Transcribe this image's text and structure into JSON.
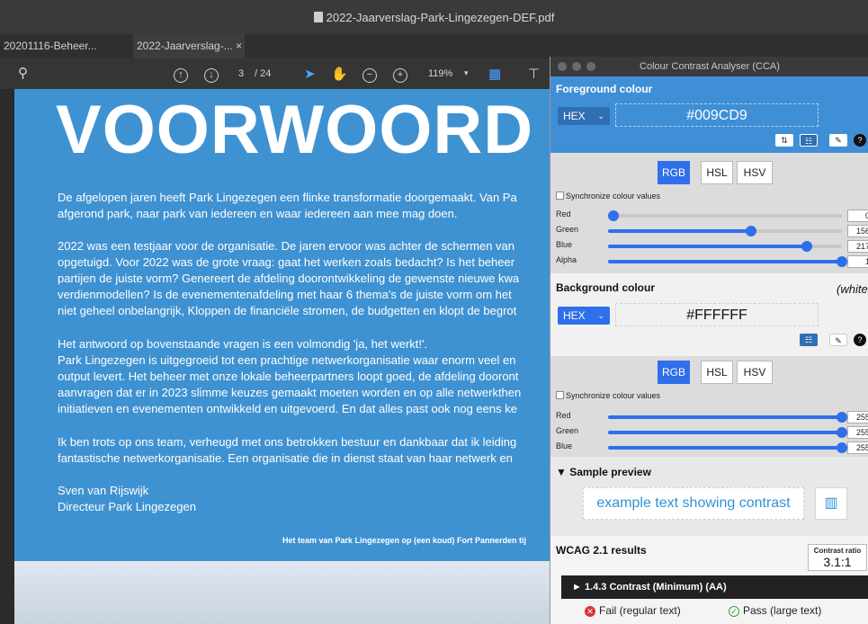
{
  "window": {
    "title": "2022-Jaarverslag-Park-Lingezegen-DEF.pdf"
  },
  "tabs": [
    {
      "label": "20201116-Beheer..."
    },
    {
      "label": "2022-Jaarverslag-...",
      "close": "×"
    }
  ],
  "toolbar": {
    "page_current": "3",
    "page_total": "/ 24",
    "zoom": "119%"
  },
  "document": {
    "heading": "VOORWOORD",
    "lines": [
      "De afgelopen jaren heeft Park Lingezegen een flinke transformatie doorgemaakt. Van Pa",
      "afgerond park, naar park van iedereen en waar iedereen aan mee mag doen.",
      "2022 was een testjaar voor de organisatie. De jaren ervoor was achter de schermen van",
      "opgetuigd. Voor 2022 was de grote vraag: gaat het werken zoals bedacht? Is het beheer",
      "partijen de juiste vorm? Genereert de afdeling doorontwikkeling de gewenste nieuwe kwa",
      "verdienmodellen?  Is de evenementenafdeling met haar 6 thema's de juiste vorm om het",
      "niet geheel onbelangrijk, Kloppen de financiële stromen, de budgetten en klopt de begrot",
      "Het antwoord op bovenstaande vragen is een volmondig 'ja, het werkt!'.",
      "Park Lingezegen is uitgegroeid tot een prachtige netwerkorganisatie waar enorm veel en",
      "output levert. Het beheer met onze lokale beheerpartners loopt goed, de afdeling dooront",
      "aanvragen dat er in 2023 slimme keuzes gemaakt moeten worden en op alle netwerkthen",
      "initiatieven en evenementen ontwikkeld en uitgevoerd. En dat alles past ook nog eens ke",
      "Ik ben trots op ons team, verheugd met ons betrokken bestuur en dankbaar dat ik leiding",
      "fantastische netwerkorganisatie. Een organisatie die in dienst staat van haar netwerk en",
      "Sven van Rijswijk",
      "Directeur Park Lingezegen"
    ],
    "caption": "Het team van Park Lingezegen op (een koud) Fort Pannerden tij"
  },
  "cca": {
    "title": "Colour Contrast Analyser (CCA)",
    "foreground": {
      "label": "Foreground colour",
      "format": "HEX",
      "hex": "#009CD9",
      "modes": [
        "RGB",
        "HSL",
        "HSV"
      ],
      "sync_label": "Synchronize colour values",
      "channels": [
        {
          "name": "Red",
          "value": "0",
          "fraction": 0.0
        },
        {
          "name": "Green",
          "value": "156",
          "fraction": 0.612
        },
        {
          "name": "Blue",
          "value": "217",
          "fraction": 0.851
        },
        {
          "name": "Alpha",
          "value": "1",
          "fraction": 1.0
        }
      ]
    },
    "background": {
      "label": "Background colour",
      "name": "(white",
      "format": "HEX",
      "hex": "#FFFFFF",
      "modes": [
        "RGB",
        "HSL",
        "HSV"
      ],
      "sync_label": "Synchronize colour values",
      "channels": [
        {
          "name": "Red",
          "value": "255",
          "fraction": 1.0
        },
        {
          "name": "Green",
          "value": "255",
          "fraction": 1.0
        },
        {
          "name": "Blue",
          "value": "255",
          "fraction": 1.0
        }
      ]
    },
    "sample": {
      "label": "▼ Sample preview",
      "text": "example text showing contrast"
    },
    "results": {
      "label": "WCAG 2.1 results",
      "ratio_label": "Contrast ratio",
      "ratio": "3.1:1",
      "criterion": "► 1.4.3 Contrast (Minimum) (AA)",
      "fail": "Fail (regular text)",
      "pass": "Pass (large text)"
    },
    "colors": {
      "accent": "#2f6fea",
      "fg_sample": "#009CD9"
    }
  }
}
